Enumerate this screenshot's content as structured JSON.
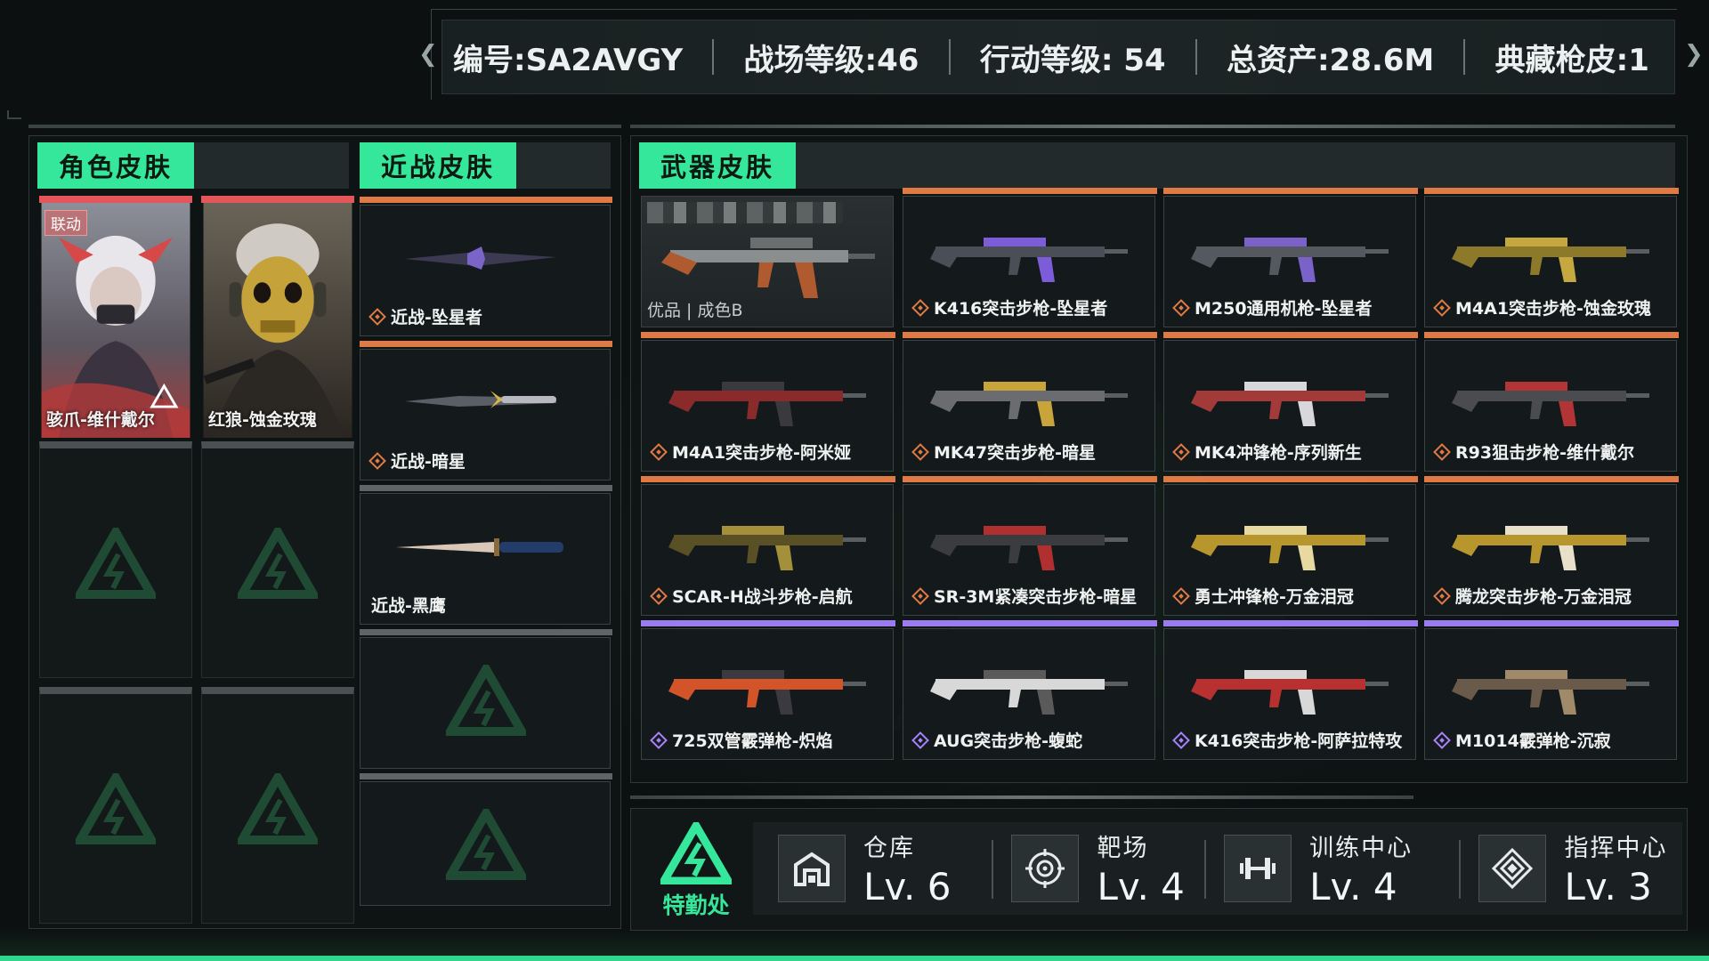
{
  "stats": {
    "id": "编号:SA2AVGY",
    "battlefield_level": "战场等级:46",
    "action_level": "行动等级: 54",
    "total_assets": "总资产:28.6M",
    "collection_skins": "典藏枪皮:1"
  },
  "tabs": {
    "character": "角色皮肤",
    "melee": "近战皮肤",
    "weapon": "武器皮肤"
  },
  "characters": [
    {
      "name": "骇爪-维什戴尔",
      "badge": "联动"
    },
    {
      "name": "红狼-蚀金玫瑰"
    }
  ],
  "melee": [
    {
      "name": "近战-坠星者"
    },
    {
      "name": "近战-暗星"
    },
    {
      "name": "近战-黑鹰"
    }
  ],
  "weapons_featured": {
    "sub": "优品 | 成色B"
  },
  "weapons": [
    {
      "name": "K416突击步枪-坠星者",
      "tier": "orange"
    },
    {
      "name": "M250通用机枪-坠星者",
      "tier": "orange"
    },
    {
      "name": "M4A1突击步枪-蚀金玫瑰",
      "tier": "orange"
    },
    {
      "name": "M4A1突击步枪-阿米娅",
      "tier": "orange"
    },
    {
      "name": "MK47突击步枪-暗星",
      "tier": "orange"
    },
    {
      "name": "MK4冲锋枪-序列新生",
      "tier": "orange"
    },
    {
      "name": "R93狙击步枪-维什戴尔",
      "tier": "orange"
    },
    {
      "name": "SCAR-H战斗步枪-启航",
      "tier": "orange"
    },
    {
      "name": "SR-3M紧凑突击步枪-暗星",
      "tier": "orange"
    },
    {
      "name": "勇士冲锋枪-万金泪冠",
      "tier": "orange"
    },
    {
      "name": "腾龙突击步枪-万金泪冠",
      "tier": "orange"
    },
    {
      "name": "725双管霰弹枪-炽焰",
      "tier": "purple"
    },
    {
      "name": "AUG突击步枪-蝮蛇",
      "tier": "purple"
    },
    {
      "name": "K416突击步枪-阿萨拉特攻",
      "tier": "purple"
    },
    {
      "name": "M1014霰弹枪-沉寂",
      "tier": "purple"
    }
  ],
  "hq": {
    "label": "特勤处"
  },
  "facilities": [
    {
      "name": "仓库",
      "level": "Lv. 6",
      "icon": "warehouse-icon"
    },
    {
      "name": "靶场",
      "level": "Lv. 4",
      "icon": "target-icon"
    },
    {
      "name": "训练中心",
      "level": "Lv. 4",
      "icon": "dumbbell-icon"
    },
    {
      "name": "指挥中心",
      "level": "Lv. 3",
      "icon": "command-icon"
    }
  ],
  "colors": {
    "accent": "#35e79a",
    "orange_tier": "#e07a45",
    "purple_tier": "#9a7cf0",
    "red_tier": "#e4565a"
  }
}
